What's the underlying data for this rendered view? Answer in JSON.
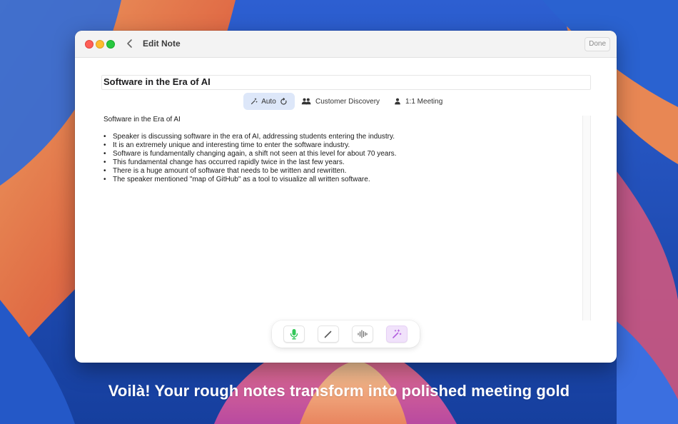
{
  "window": {
    "title": "Edit Note",
    "done_label": "Done"
  },
  "note": {
    "title": "Software in the Era of AI",
    "heading": "Software in the Era of AI",
    "bullets": [
      "Speaker is discussing software in the era of AI, addressing students entering the industry.",
      "It is an extremely unique and interesting time to enter the software industry.",
      "Software is fundamentally changing again, a shift not seen at this level for about 70 years.",
      "This fundamental change has occurred rapidly twice in the last few years.",
      "There is a huge amount of software that needs to be written and rewritten.",
      "The speaker mentioned \"map of GitHub\" as a tool to visualize all written software."
    ]
  },
  "chips": {
    "auto": "Auto",
    "customer_discovery": "Customer Discovery",
    "meeting": "1:1 Meeting"
  },
  "toolbar": {
    "icons": [
      "microphone-icon",
      "pencil-icon",
      "waveform-icon",
      "magic-wand-icon"
    ]
  },
  "colors": {
    "accent_chip": "#dde7f9",
    "mic_green": "#34c759",
    "magic_purple": "#b35ddf"
  },
  "caption": "Voilà! Your rough notes transform into polished meeting gold"
}
